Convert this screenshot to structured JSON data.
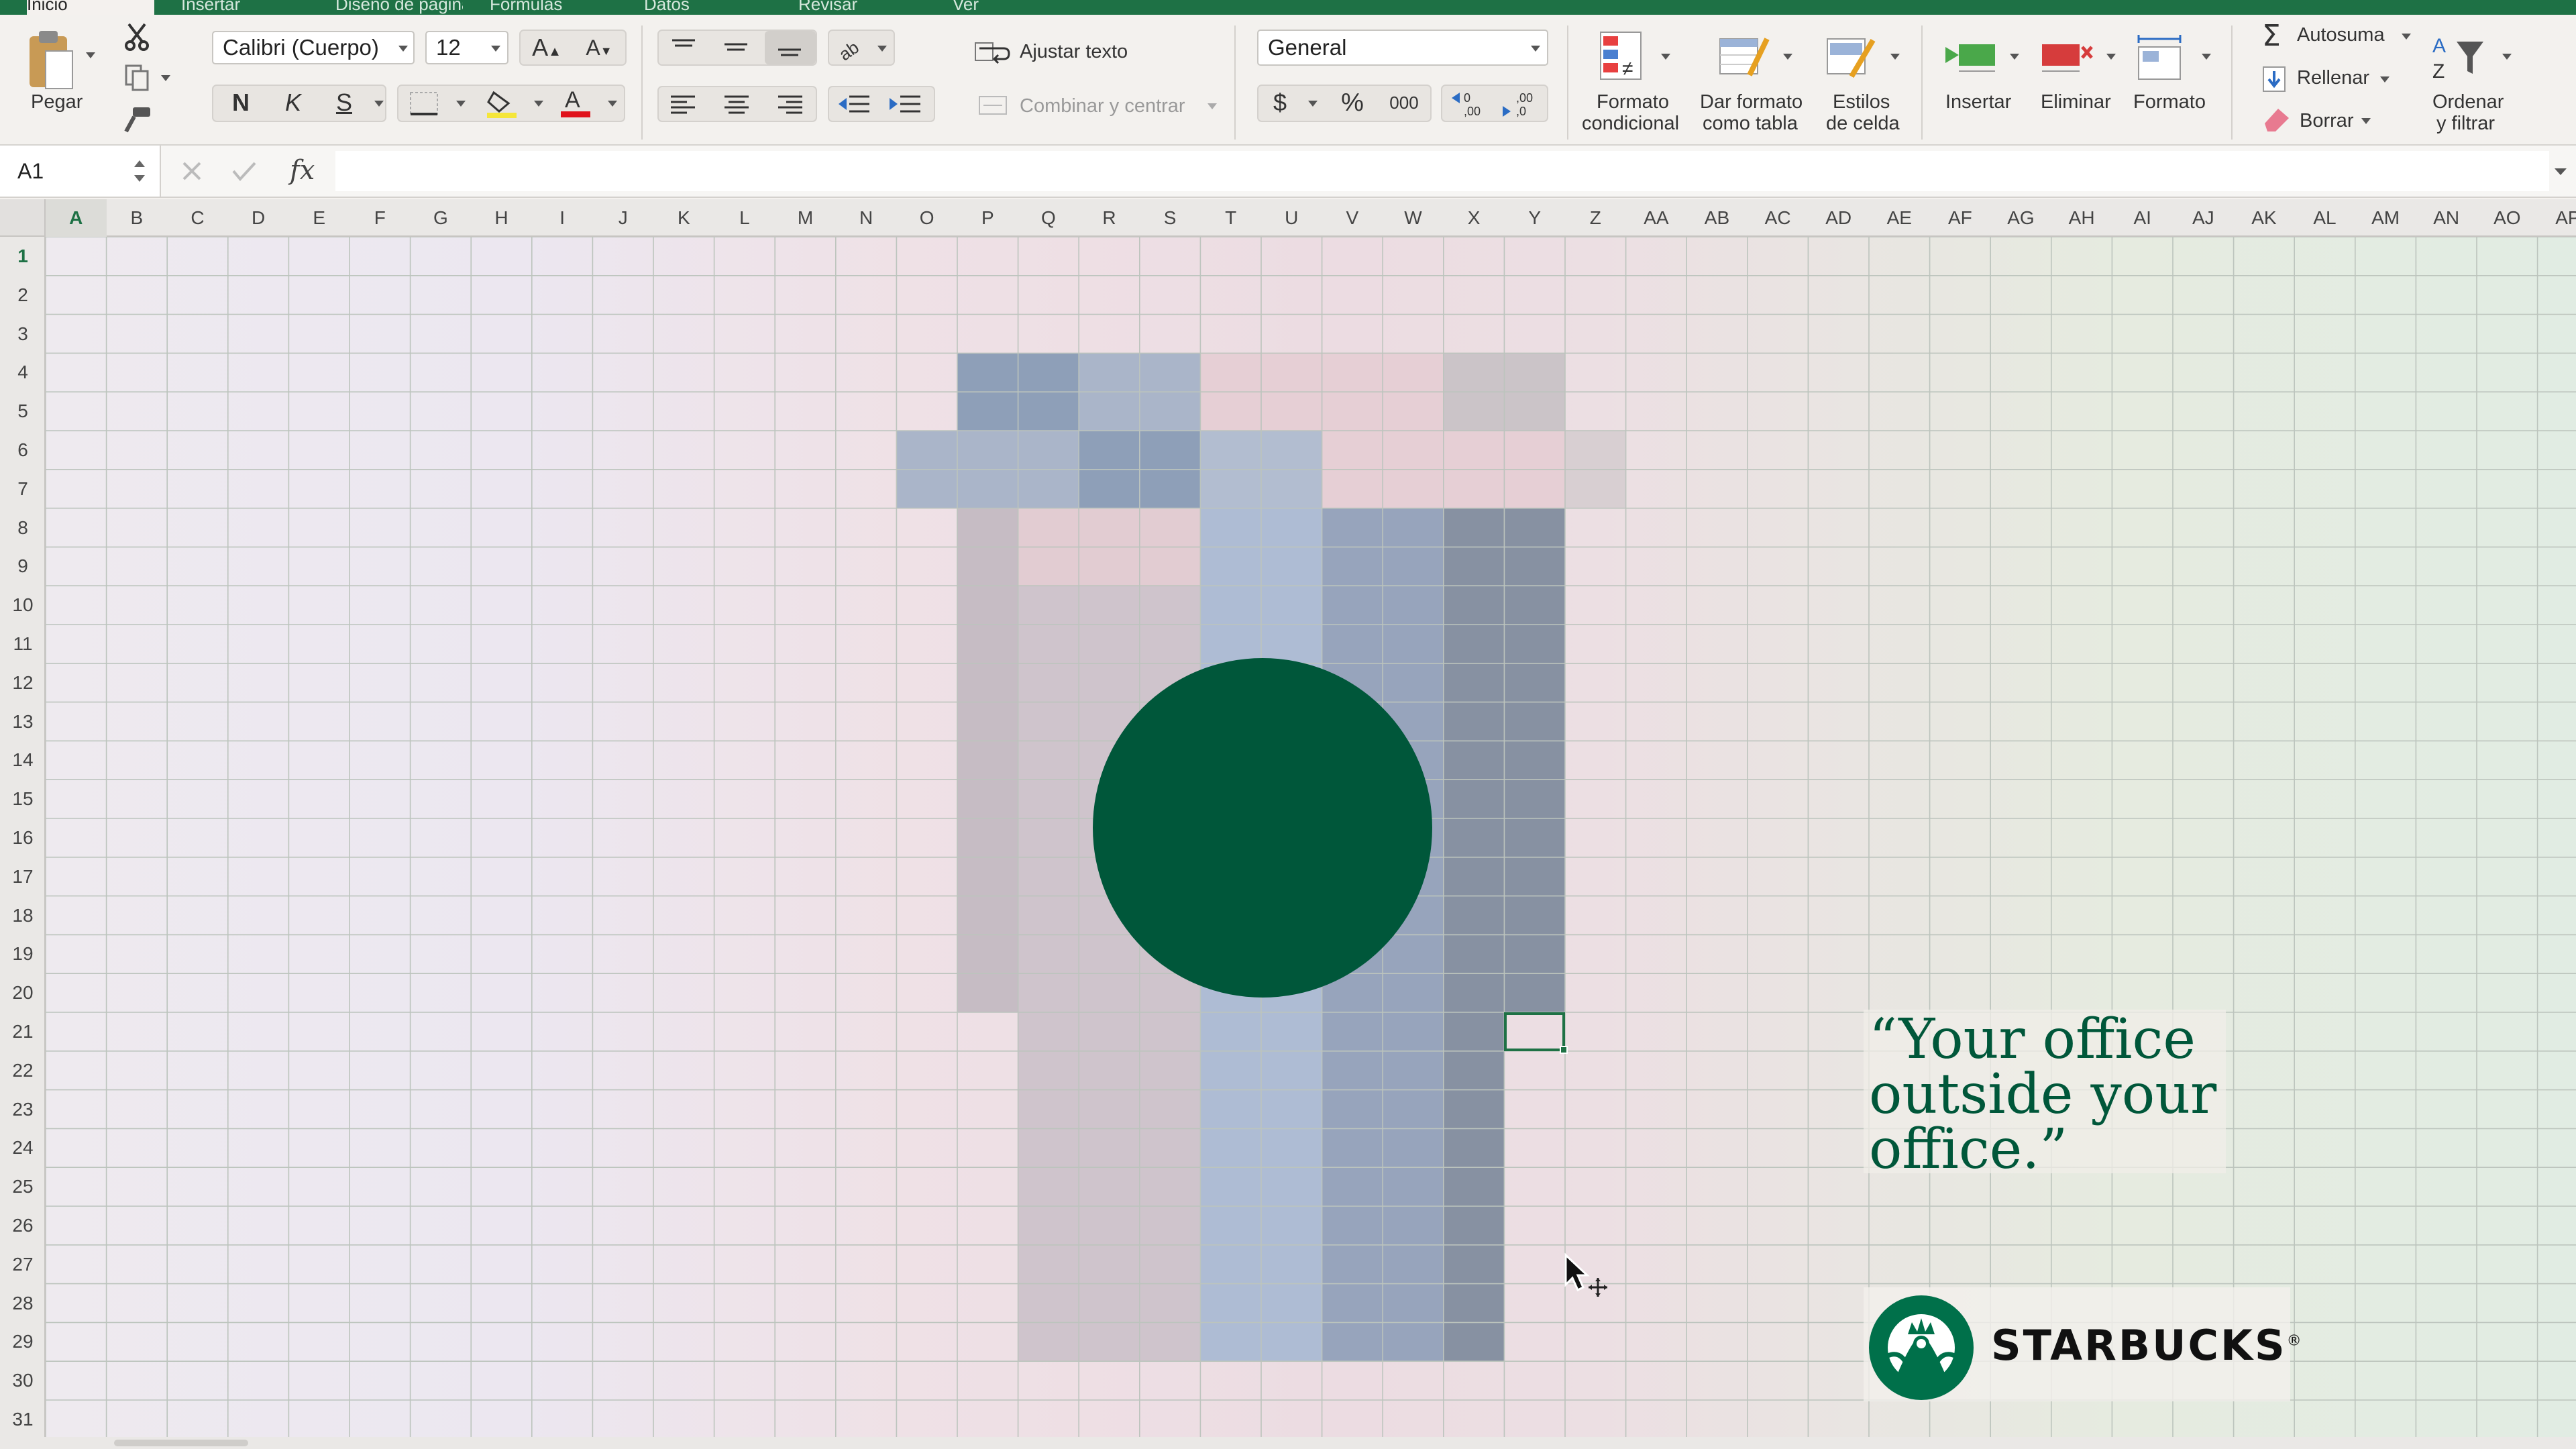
{
  "tabs": [
    "Inicio",
    "Insertar",
    "Diseño de página",
    "Fórmulas",
    "Datos",
    "Revisar",
    "Ver"
  ],
  "ribbon": {
    "paste_label": "Pegar",
    "font_name": "Calibri (Cuerpo)",
    "font_size": "12",
    "bold": "N",
    "italic": "K",
    "underline": "S",
    "wrap_text": "Ajustar texto",
    "merge_center": "Combinar y centrar",
    "number_format": "General",
    "currency": "$",
    "percent": "%",
    "thousands": "000",
    "cond_format": [
      "Formato",
      "condicional"
    ],
    "format_table": [
      "Dar formato",
      "como tabla"
    ],
    "cell_styles": [
      "Estilos",
      "de celda"
    ],
    "insert": "Insertar",
    "delete": "Eliminar",
    "format": "Formato",
    "autosum": "Autosuma",
    "fill": "Rellenar",
    "clear": "Borrar",
    "sort_filter": [
      "Ordenar",
      "y filtrar"
    ]
  },
  "formula_bar": {
    "name_box": "A1",
    "fx": "fx"
  },
  "columns": [
    "A",
    "B",
    "C",
    "D",
    "E",
    "F",
    "G",
    "H",
    "I",
    "J",
    "K",
    "L",
    "M",
    "N",
    "O",
    "P",
    "Q",
    "R",
    "S",
    "T",
    "U",
    "V",
    "W",
    "X",
    "Y",
    "Z",
    "AA",
    "AB",
    "AC",
    "AD",
    "AE",
    "AF",
    "AG",
    "AH",
    "AI",
    "AJ",
    "AK",
    "AL",
    "AM",
    "AN",
    "AO",
    "AP"
  ],
  "rows": [
    "1",
    "2",
    "3",
    "4",
    "5",
    "6",
    "7",
    "8",
    "9",
    "10",
    "11",
    "12",
    "13",
    "14",
    "15",
    "16",
    "17",
    "18",
    "19",
    "20",
    "21",
    "22",
    "23",
    "24",
    "25",
    "26",
    "27",
    "28",
    "29",
    "30",
    "31"
  ],
  "selected_cell": "A1",
  "ad": {
    "tagline": [
      "“Your office",
      "outside your",
      "office.”"
    ],
    "brand": "STARBUCKS",
    "registered": "®"
  },
  "colors": {
    "excel_green": "#1e7145",
    "starbucks_green": "#00573a"
  }
}
